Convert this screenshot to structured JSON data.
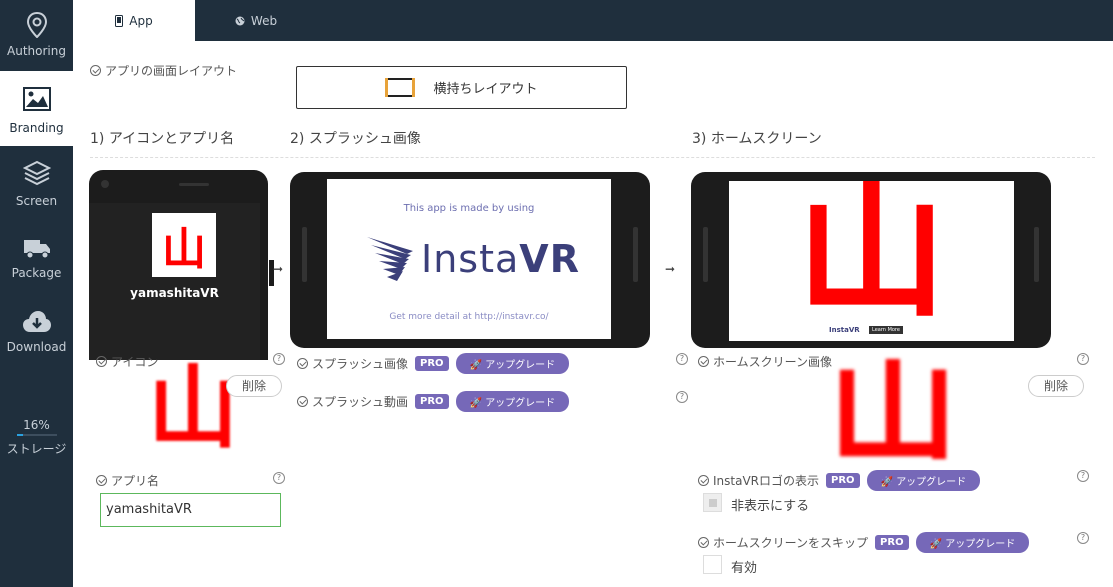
{
  "sidebar": {
    "items": [
      {
        "label": "Authoring",
        "icon": "location-pin-icon"
      },
      {
        "label": "Branding",
        "icon": "image-icon"
      },
      {
        "label": "Screen",
        "icon": "layers-icon"
      },
      {
        "label": "Package",
        "icon": "truck-icon"
      },
      {
        "label": "Download",
        "icon": "cloud-download-icon"
      }
    ],
    "storage_percent": "16%",
    "storage_fraction": 0.16,
    "storage_label": "ストレージ"
  },
  "tabs": [
    {
      "label": "App",
      "icon": "phone-icon"
    },
    {
      "label": "Web",
      "icon": "globe-icon"
    }
  ],
  "layout": {
    "label": "アプリの画面レイアウト",
    "button_label": "横持ちレイアウト"
  },
  "sections": {
    "icon_and_name": "1) アイコンとアプリ名",
    "splash": "2) スプラッシュ画像",
    "home": "3) ホームスクリーン"
  },
  "preview": {
    "app_name": "yamashitaVR",
    "splash_top": "This app is made by using",
    "splash_brand_light": "Insta",
    "splash_brand_bold": "VR",
    "splash_bottom": "Get more detail at http://instavr.co/",
    "kanji": "山",
    "home_logo_text": "InstaVR",
    "home_logo_button": "Learn More"
  },
  "fields": {
    "icon_label": "アイコン",
    "delete_label": "削除",
    "app_name_label": "アプリ名",
    "app_name_value": "yamashitaVR",
    "splash_image_label": "スプラッシュ画像",
    "splash_video_label": "スプラッシュ動画",
    "pro_label": "PRO",
    "upgrade_label": "アップグレード",
    "home_image_label": "ホームスクリーン画像",
    "instavr_logo_label": "InstaVRロゴの表示",
    "hide_label": "非表示にする",
    "skip_home_label": "ホームスクリーンをスキップ",
    "enable_label": "有効"
  },
  "colors": {
    "sidebar_bg": "#1f2f3d",
    "accent_purple": "#7668b8",
    "kanji_red": "#ff0000",
    "instavr_navy": "#3b3f7a"
  }
}
